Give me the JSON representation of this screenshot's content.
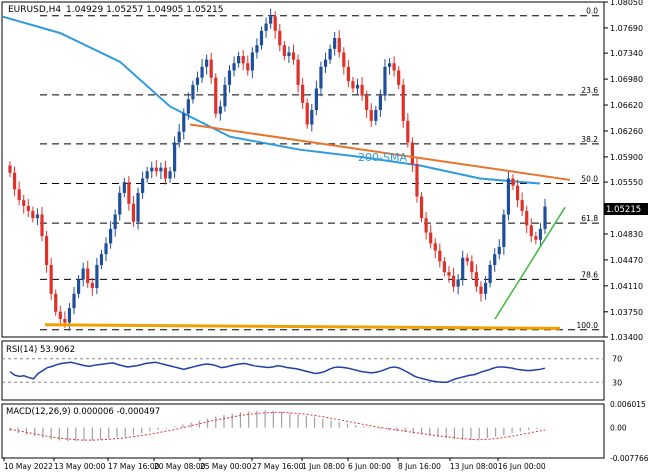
{
  "colors": {
    "background": "#ffffff",
    "frame": "#000000",
    "bull_candle": "#1f4e9c",
    "bear_candle": "#e0302a",
    "sma": "#2e9ae0",
    "resistance_line": "#e8752b",
    "support_line": "#f0a000",
    "trend_line": "#3dbb3d",
    "rsi_line": "#1f3fa8",
    "macd_hist": "#a0a0a0",
    "macd_signal": "#e0302a",
    "price_tag_bg": "#000000",
    "price_tag_fg": "#ffffff"
  },
  "header": {
    "symbol": "EURUSD,H4",
    "ohlc": "1.04929 1.05257 1.04905 1.05215"
  },
  "chart_data": [
    {
      "type": "candlestick",
      "title": "EURUSD,H4",
      "ylim": [
        1.034,
        1.0805
      ],
      "y_ticks": [
        1.0805,
        1.0769,
        1.0734,
        1.0698,
        1.0662,
        1.0626,
        1.059,
        1.0555,
        1.0483,
        1.0447,
        1.0411,
        1.0375,
        1.034
      ],
      "y_tick_labels": [
        "1.08050",
        "1.07690",
        "1.07340",
        "1.06980",
        "1.06620",
        "1.06260",
        "1.05900",
        "1.05550",
        "1.04830",
        "1.04470",
        "1.04110",
        "1.03750",
        "1.03400"
      ],
      "x_tick_labels": [
        "10 May 2022",
        "13 May 00:00",
        "17 May 16:00",
        "20 May 08:00",
        "25 May 00:00",
        "27 May 16:00",
        "1 Jun 08:00",
        "6 Jun 00:00",
        "8 Jun 16:00",
        "13 Jun 08:00",
        "16 Jun 00:00"
      ],
      "grid": false,
      "last_price": 1.05215,
      "last_price_label": "1.05215",
      "closes": [
        1.0568,
        1.0545,
        1.053,
        1.0522,
        1.0515,
        1.0505,
        1.051,
        1.048,
        1.044,
        1.04,
        1.0375,
        1.0365,
        1.036,
        1.038,
        1.04,
        1.042,
        1.0435,
        1.0415,
        1.0408,
        1.044,
        1.0455,
        1.047,
        1.049,
        1.051,
        1.054,
        1.0555,
        1.0525,
        1.05,
        1.054,
        1.056,
        1.057,
        1.0575,
        1.057,
        1.0575,
        1.056,
        1.057,
        1.061,
        1.0625,
        1.065,
        1.067,
        1.069,
        1.07,
        1.0715,
        1.0725,
        1.07,
        1.065,
        1.066,
        1.069,
        1.071,
        1.072,
        1.073,
        1.072,
        1.071,
        1.0735,
        1.0745,
        1.0765,
        1.0775,
        1.0785,
        1.0765,
        1.0745,
        1.073,
        1.0735,
        1.0725,
        1.069,
        1.0665,
        1.0635,
        1.0655,
        1.0685,
        1.0715,
        1.0725,
        1.074,
        1.0755,
        1.0735,
        1.0715,
        1.0695,
        1.0685,
        1.069,
        1.0675,
        1.0655,
        1.064,
        1.0655,
        1.0675,
        1.0715,
        1.072,
        1.071,
        1.069,
        1.064,
        1.061,
        1.058,
        1.0535,
        1.0505,
        1.0485,
        1.047,
        1.046,
        1.0445,
        1.043,
        1.0425,
        1.041,
        1.042,
        1.045,
        1.0445,
        1.043,
        1.041,
        1.04,
        1.0415,
        1.044,
        1.0455,
        1.0465,
        1.051,
        1.056,
        1.055,
        1.053,
        1.0515,
        1.0495,
        1.048,
        1.0475,
        1.049,
        1.0521
      ],
      "indicators": {
        "sma_label": "200-SMA",
        "sma_period": 200
      },
      "fibonacci": {
        "levels": [
          {
            "label": "0.0",
            "price": 1.0786
          },
          {
            "label": "23.6",
            "price": 1.0676
          },
          {
            "label": "38.2",
            "price": 1.0608
          },
          {
            "label": "50.0",
            "price": 1.0553
          },
          {
            "label": "61.8",
            "price": 1.0498
          },
          {
            "label": "78.6",
            "price": 1.042
          },
          {
            "label": "100.0",
            "price": 1.035
          }
        ]
      }
    },
    {
      "type": "line",
      "title": "RSI(14) 53.9062",
      "ylim": [
        0,
        100
      ],
      "y_ticks": [
        70,
        30
      ],
      "y_tick_labels": [
        "70",
        "30"
      ],
      "levels": [
        70,
        30
      ],
      "values": [
        48,
        42,
        40,
        41,
        38,
        36,
        45,
        50,
        55,
        57,
        60,
        62,
        63,
        64,
        62,
        60,
        58,
        57,
        59,
        60,
        61,
        62,
        63,
        60,
        58,
        56,
        57,
        58,
        60,
        62,
        63,
        64,
        62,
        60,
        58,
        56,
        54,
        52,
        54,
        56,
        58,
        60,
        61,
        60,
        58,
        55,
        56,
        58,
        60,
        61,
        62,
        60,
        58,
        57,
        56,
        55,
        56,
        58,
        57,
        55,
        54,
        53,
        51,
        49,
        47,
        45,
        46,
        48,
        52,
        55,
        56,
        55,
        54,
        52,
        50,
        48,
        47,
        46,
        47,
        49,
        52,
        55,
        56,
        54,
        50,
        46,
        41,
        38,
        36,
        34,
        32,
        31,
        30,
        30,
        33,
        36,
        38,
        40,
        42,
        43,
        46,
        49,
        51,
        54,
        56,
        56,
        55,
        54,
        52,
        51,
        50,
        50,
        51,
        52,
        53.9
      ]
    },
    {
      "type": "bar",
      "title": "MACD(12,26,9) 0.000006 -0.000497",
      "ylim": [
        -0.00776,
        0.00603
      ],
      "y_ticks": [
        0.006015,
        0.0,
        -0.007766
      ],
      "y_tick_labels": [
        "0.006015",
        "0.00",
        "-0.007766"
      ],
      "series": [
        {
          "name": "MACD",
          "values": [
            -0.0008,
            -0.0014,
            -0.0018,
            -0.0022,
            -0.0026,
            -0.003,
            -0.0033,
            -0.0034,
            -0.0035,
            -0.0034,
            -0.0033,
            -0.0031,
            -0.0028,
            -0.0025,
            -0.0022,
            -0.0018,
            -0.0014,
            -0.001,
            -0.0006,
            -0.0002,
            0.0003,
            0.0008,
            0.0013,
            0.0018,
            0.0023,
            0.0028,
            0.0032,
            0.0036,
            0.0039,
            0.0041,
            0.0043,
            0.0044,
            0.0043,
            0.0041,
            0.0038,
            0.0034,
            0.003,
            0.0026,
            0.0022,
            0.0018,
            0.0014,
            0.001,
            0.0006,
            0.0003,
            0.0,
            -0.0003,
            -0.0006,
            -0.0009,
            -0.0012,
            -0.0015,
            -0.0018,
            -0.0021,
            -0.0024,
            -0.0027,
            -0.0029,
            -0.0031,
            -0.0032,
            -0.003,
            -0.0027,
            -0.0023,
            -0.0019,
            -0.0014,
            -0.001,
            -0.0006,
            -0.0003,
            -0.0001
          ]
        },
        {
          "name": "Signal",
          "values": [
            -0.0004,
            -0.0008,
            -0.0012,
            -0.0016,
            -0.002,
            -0.0024,
            -0.0027,
            -0.0029,
            -0.0031,
            -0.0032,
            -0.0032,
            -0.0031,
            -0.003,
            -0.0028,
            -0.0026,
            -0.0023,
            -0.002,
            -0.0017,
            -0.0013,
            -0.0009,
            -0.0005,
            0.0,
            0.0005,
            0.001,
            0.0015,
            0.0019,
            0.0023,
            0.0027,
            0.0031,
            0.0034,
            0.0036,
            0.0038,
            0.0039,
            0.0039,
            0.0038,
            0.0036,
            0.0034,
            0.0031,
            0.0028,
            0.0024,
            0.002,
            0.0016,
            0.0012,
            0.0008,
            0.0004,
            0.0,
            -0.0003,
            -0.0006,
            -0.0009,
            -0.0012,
            -0.0015,
            -0.0018,
            -0.0021,
            -0.0023,
            -0.0026,
            -0.0028,
            -0.003,
            -0.0031,
            -0.003,
            -0.0028,
            -0.0025,
            -0.0022,
            -0.0018,
            -0.0014,
            -0.001,
            -0.0006
          ]
        }
      ]
    }
  ]
}
